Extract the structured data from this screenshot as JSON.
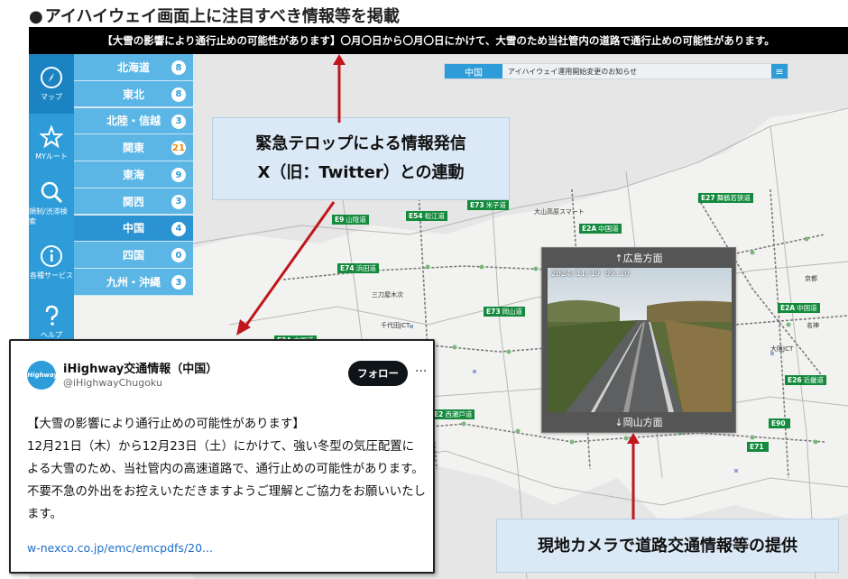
{
  "heading": {
    "bullet": "●",
    "text": "アイハイウェイ画面上に注目すべき情報等を掲載"
  },
  "alert_bar": {
    "text": "【大雪の影響により通行止めの可能性があります】〇月〇日から〇月〇日にかけて、大雪のため当社管内の道路で通行止めの可能性があります。"
  },
  "icon_rail": {
    "items": [
      {
        "label": "マップ",
        "icon": "compass-icon"
      },
      {
        "label": "MYルート",
        "icon": "star-icon"
      },
      {
        "label": "規制/渋滞検索",
        "icon": "search-icon"
      },
      {
        "label": "各種サービス",
        "icon": "info-icon"
      },
      {
        "label": "ヘルプ",
        "icon": "help-icon"
      }
    ]
  },
  "regions": [
    {
      "name": "北海道",
      "count": "8"
    },
    {
      "name": "東北",
      "count": "8"
    },
    {
      "name": "北陸・信越",
      "count": "3"
    },
    {
      "name": "関東",
      "count": "21"
    },
    {
      "name": "東海",
      "count": "9"
    },
    {
      "name": "関西",
      "count": "3"
    },
    {
      "name": "中国",
      "count": "4"
    },
    {
      "name": "四国",
      "count": "0"
    },
    {
      "name": "九州・沖縄",
      "count": "3"
    }
  ],
  "notice": {
    "region": "中国",
    "text": "アイハイウェイ運用開始変更のお知らせ",
    "menu": "≡"
  },
  "map_tags": [
    {
      "code": "E9",
      "name": "山陰道"
    },
    {
      "code": "E54",
      "name": "松江道"
    },
    {
      "code": "E73",
      "name": "米子道"
    },
    {
      "code": "E2A",
      "name": "中国道"
    },
    {
      "code": "E27",
      "name": "舞鶴若狭道"
    },
    {
      "code": "E74",
      "name": "浜田道"
    },
    {
      "code": "E73",
      "name": "岡山道"
    },
    {
      "code": "E2A",
      "name": "中国道"
    },
    {
      "code": "E2A",
      "name": "中国道"
    },
    {
      "code": "E26",
      "name": "近畿道"
    },
    {
      "code": "E90",
      "name": ""
    },
    {
      "code": "E71",
      "name": ""
    },
    {
      "code": "E2",
      "name": "西瀬戸道"
    }
  ],
  "map_places": [
    "大山高原スマート",
    "三刀屋木次",
    "千代田JCT",
    "大阪JCT",
    "京都",
    "名神"
  ],
  "camera": {
    "top_label": "↑広島方面",
    "timestamp": "2024/11/19 09:10",
    "bottom_label": "↓岡山方面"
  },
  "callouts": {
    "top_line1": "緊急テロップによる情報発信",
    "top_line2": "X（旧：Twitter）との連動",
    "bottom": "現地カメラで道路交通情報等の提供"
  },
  "tweet": {
    "avatar_text": "iHighway",
    "name": "iHighway交通情報（中国）",
    "handle": "@iHighwayChugoku",
    "follow": "フォロー",
    "more": "···",
    "lines": [
      "【大雪の影響により通行止めの可能性があります】",
      "12月21日（木）から12月23日（土）にかけて、強い冬型の気圧配置に",
      "よる大雪のため、当社管内の高速道路で、通行止めの可能性があります。",
      "不要不急の外出をお控えいただきますようご理解とご協力をお願いいたし",
      "ます。"
    ],
    "link": "w-nexco.co.jp/emc/emcpdfs/20..."
  },
  "colors": {
    "rail": "#2e9cd9",
    "alert_bg": "#000000",
    "arrow": "#c0161c",
    "road_tag": "#138a3c"
  }
}
